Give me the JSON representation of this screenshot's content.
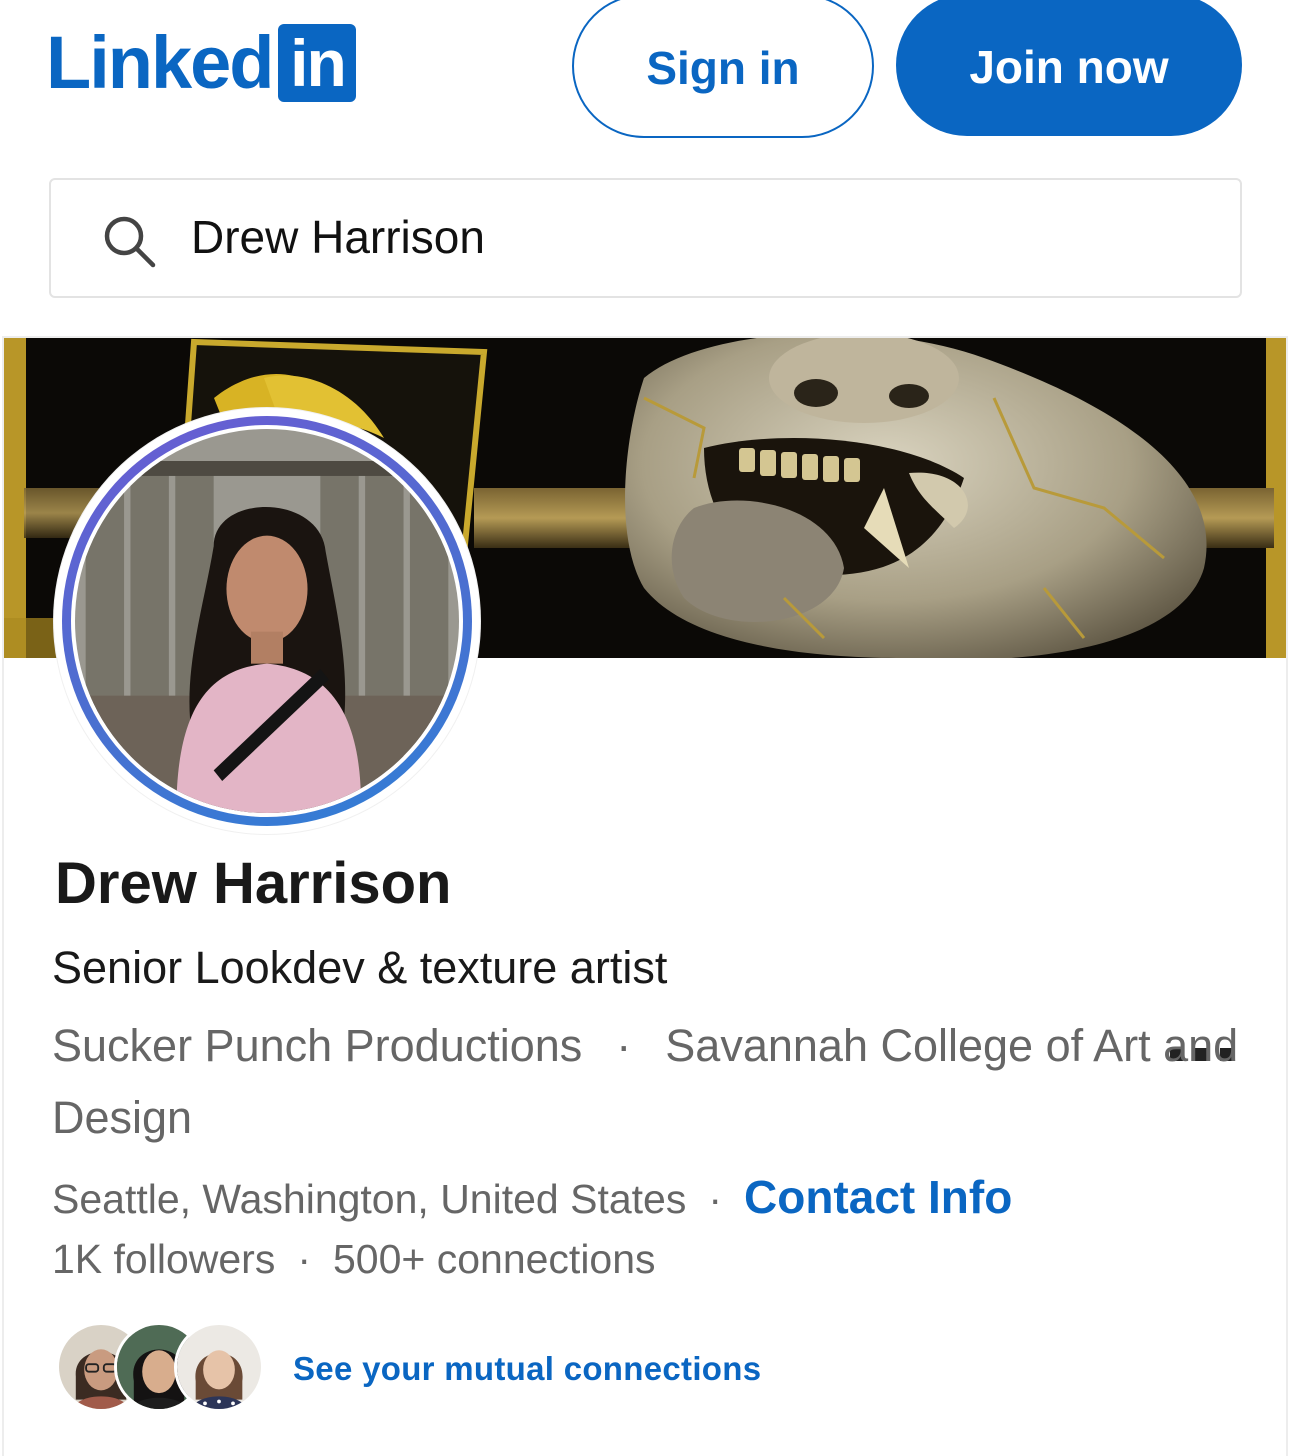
{
  "header": {
    "logo_word": "Linked",
    "logo_box": "in",
    "signin_label": "Sign in",
    "join_label": "Join now"
  },
  "search": {
    "value": "Drew Harrison",
    "icon": "search-icon"
  },
  "profile": {
    "name": "Drew Harrison",
    "headline": "Senior Lookdev & texture artist",
    "company": "Sucker Punch Productions",
    "school": "Savannah College of Art and Design",
    "separator": "·",
    "location": "Seattle, Washington, United States",
    "contact_label": "Contact Info",
    "followers": "1K followers",
    "connections": "500+ connections",
    "mutual_link": "See your mutual connections",
    "more_icon": "more-options-icon"
  },
  "colors": {
    "brand": "#0a66c2",
    "text_primary": "#191919",
    "text_secondary": "#666666"
  }
}
